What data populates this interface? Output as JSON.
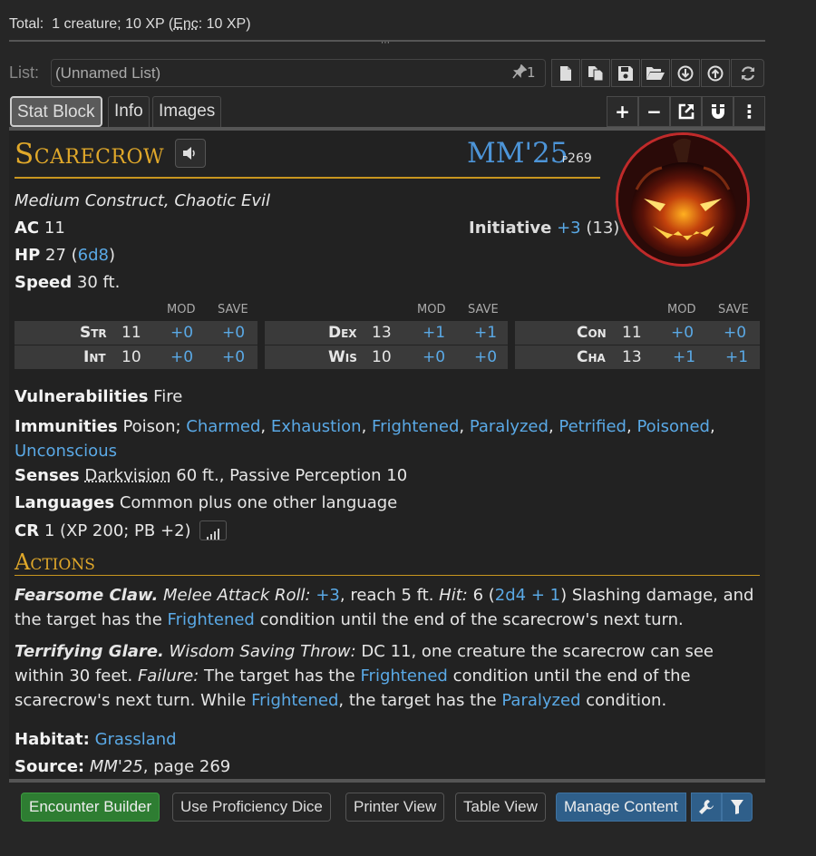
{
  "total": {
    "label": "Total:",
    "text": "1 creature; 10 XP (",
    "enc": "Enc",
    "enc_rest": ": 10 XP)"
  },
  "grip": "⋯",
  "list": {
    "label": "List:",
    "value": "(Unnamed List)",
    "pin_count": "1"
  },
  "toolbar_icons": [
    "new-file-icon",
    "copy-icon",
    "save-icon",
    "folder-open-icon",
    "download-icon",
    "upload-icon",
    "refresh-icon"
  ],
  "tabs": [
    {
      "label": "Stat Block",
      "active": true
    },
    {
      "label": "Info",
      "active": false
    },
    {
      "label": "Images",
      "active": false
    }
  ],
  "tools": {
    "plus": "+",
    "minus": "−",
    "more": "⋮"
  },
  "creature": {
    "name": "Scarecrow",
    "source_abbr": "MM'25",
    "source_page": "p269",
    "type": "Medium Construct, Chaotic Evil",
    "ac_label": "AC",
    "ac": "11",
    "initiative_label": "Initiative",
    "initiative_mod": "+3",
    "initiative_score": "(13)",
    "hp_label": "HP",
    "hp": "27 (",
    "hp_dice": "6d8",
    "hp_close": ")",
    "speed_label": "Speed",
    "speed": "30 ft.",
    "abilities": [
      {
        "name": "Str",
        "score": "11",
        "mod": "+0",
        "save": "+0"
      },
      {
        "name": "Dex",
        "score": "13",
        "mod": "+1",
        "save": "+1"
      },
      {
        "name": "Con",
        "score": "11",
        "mod": "+0",
        "save": "+0"
      },
      {
        "name": "Int",
        "score": "10",
        "mod": "+0",
        "save": "+0"
      },
      {
        "name": "Wis",
        "score": "10",
        "mod": "+0",
        "save": "+0"
      },
      {
        "name": "Cha",
        "score": "13",
        "mod": "+1",
        "save": "+1"
      }
    ],
    "mod_header": "MOD",
    "save_header": "SAVE",
    "vulnerabilities_label": "Vulnerabilities",
    "vulnerabilities": "Fire",
    "immunities_label": "Immunities",
    "immunities_plain": "Poison;",
    "condition_immunities": [
      "Charmed",
      "Exhaustion",
      "Frightened",
      "Paralyzed",
      "Petrified",
      "Poisoned",
      "Unconscious"
    ],
    "senses_label": "Senses",
    "senses_dark": "Darkvision",
    "senses_rest": "60 ft., Passive Perception 10",
    "languages_label": "Languages",
    "languages": "Common plus one other language",
    "cr_label": "CR",
    "cr": "1 (XP 200; PB +2)",
    "actions_title": "Actions",
    "action1": {
      "name": "Fearsome Claw.",
      "type": "Melee Attack Roll:",
      "bonus": "+3",
      "t1": ", reach 5 ft.",
      "hit_label": "Hit:",
      "t2": "6 (",
      "dice": "2d4 + 1",
      "t3": ") Slashing damage, and the target has the",
      "cond": "Frightened",
      "t4": "condition until the end of the scarecrow's next turn."
    },
    "action2": {
      "name": "Terrifying Glare.",
      "type": "Wisdom Saving Throw:",
      "t1": "DC 11, one creature the scarecrow can see within 30 feet.",
      "fail_label": "Failure:",
      "t2": "The target has the",
      "cond1": "Frightened",
      "t3": "condition until the end of the scarecrow's next turn. While",
      "cond2": "Frightened",
      "t4": ", the target has the",
      "cond3": "Paralyzed",
      "t5": "condition."
    },
    "habitat_label": "Habitat:",
    "habitat": "Grassland",
    "source_label": "Source:",
    "source_book": "MM'25",
    "source_rest": ", page 269"
  },
  "footer": {
    "encounter": "Encounter Builder",
    "prof_dice": "Use Proficiency Dice",
    "printer": "Printer View",
    "table": "Table View",
    "manage": "Manage Content"
  },
  "colors": {
    "accent_gold": "#e0a82a",
    "link_blue": "#5aa9e6",
    "encounter_green": "#2e7d32",
    "manage_blue": "#2f5f8a"
  }
}
